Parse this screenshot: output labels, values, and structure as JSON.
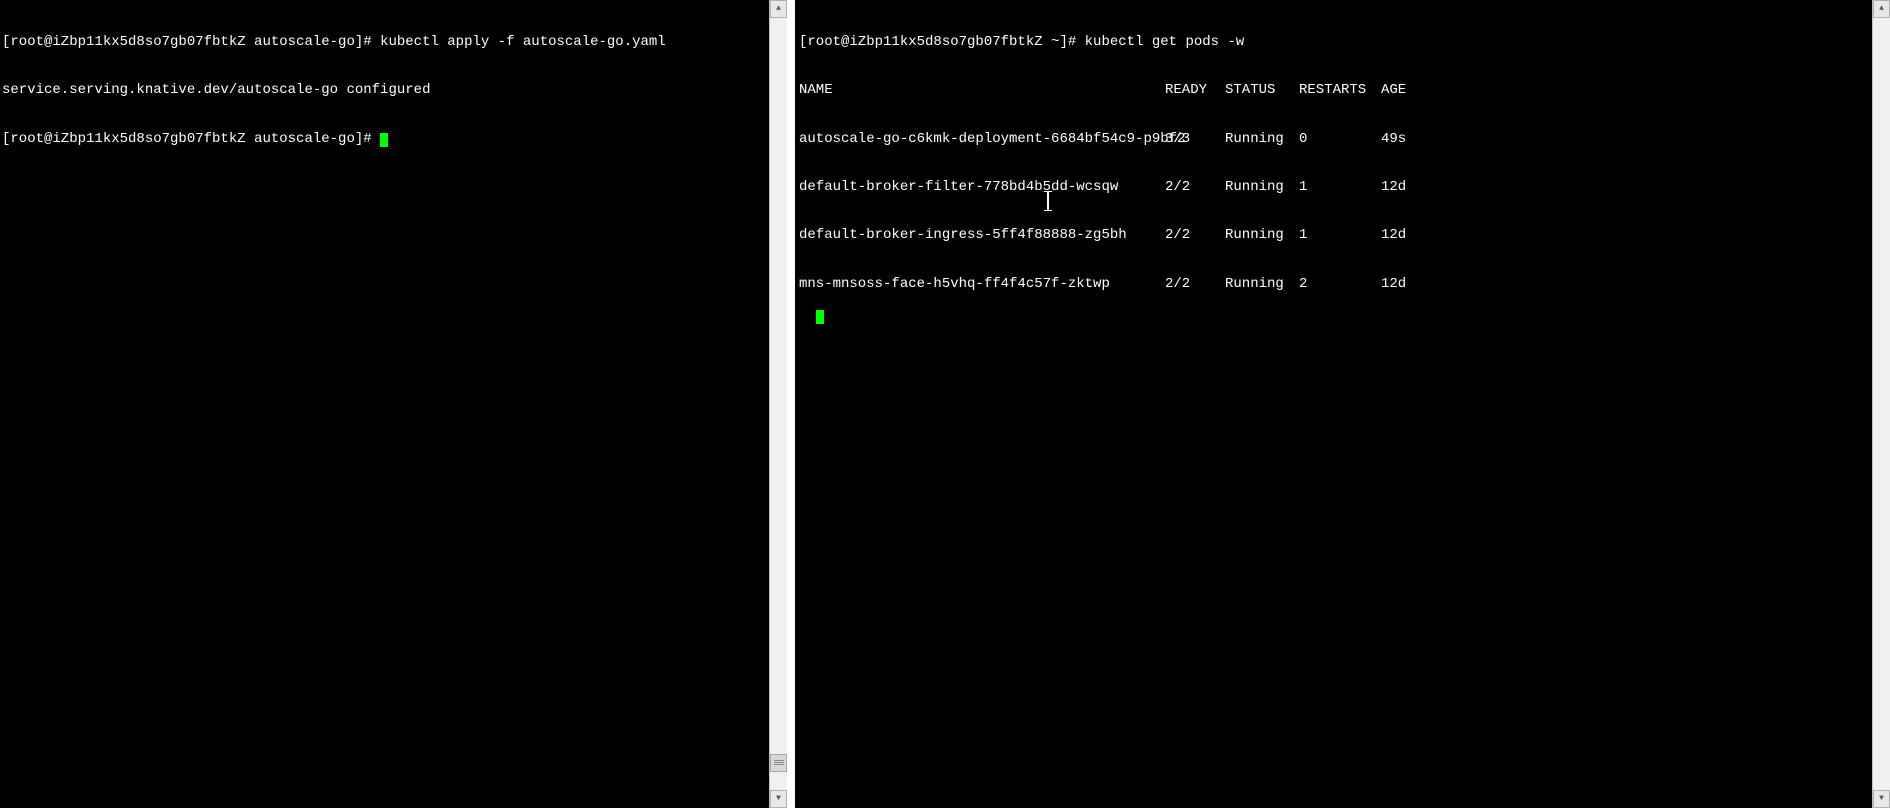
{
  "left_pane": {
    "line1_prompt": "[root@iZbp11kx5d8so7gb07fbtkZ autoscale-go]# ",
    "line1_cmd": "kubectl apply -f autoscale-go.yaml",
    "line2_output": "service.serving.knative.dev/autoscale-go configured",
    "line3_prompt": "[root@iZbp11kx5d8so7gb07fbtkZ autoscale-go]# "
  },
  "right_pane": {
    "prompt": "[root@iZbp11kx5d8so7gb07fbtkZ ~]# ",
    "cmd": "kubectl get pods -w",
    "headers": {
      "name": "NAME",
      "ready": "READY",
      "status": "STATUS",
      "restarts": "RESTARTS",
      "age": "AGE"
    },
    "rows": [
      {
        "name": "autoscale-go-c6kmk-deployment-6684bf54c9-p9bf2",
        "ready": "3/3",
        "status": "Running",
        "restarts": "0",
        "age": "49s"
      },
      {
        "name": "default-broker-filter-778bd4b5dd-wcsqw",
        "ready": "2/2",
        "status": "Running",
        "restarts": "1",
        "age": "12d"
      },
      {
        "name": "default-broker-ingress-5ff4f88888-zg5bh",
        "ready": "2/2",
        "status": "Running",
        "restarts": "1",
        "age": "12d"
      },
      {
        "name": "mns-mnsoss-face-h5vhq-ff4f4c57f-zktwp",
        "ready": "2/2",
        "status": "Running",
        "restarts": "2",
        "age": "12d"
      }
    ]
  }
}
